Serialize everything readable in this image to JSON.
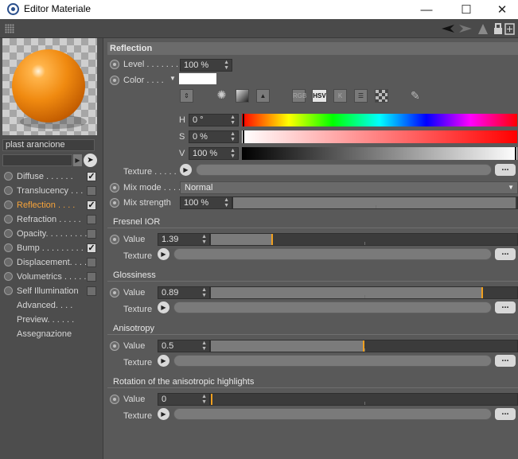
{
  "window": {
    "title": "Editor Materiale",
    "minimize": "—",
    "maximize": "☐",
    "close": "✕"
  },
  "material": {
    "name": "plast arancione"
  },
  "channels": [
    {
      "label": "Diffuse . . . . . .",
      "checked": true,
      "active": false
    },
    {
      "label": "Translucency . . .",
      "checked": false,
      "active": false
    },
    {
      "label": "Reflection . . . .",
      "checked": true,
      "active": true
    },
    {
      "label": "Refraction . . . . .",
      "checked": false,
      "active": false
    },
    {
      "label": "Opacity. . . . . . . . .",
      "checked": false,
      "active": false
    },
    {
      "label": "Bump . . . . . . . . .",
      "checked": true,
      "active": false
    },
    {
      "label": "Displacement. . . .",
      "checked": false,
      "active": false
    },
    {
      "label": "Volumetrics . . . . .",
      "checked": false,
      "active": false
    },
    {
      "label": "Self Illumination",
      "checked": false,
      "active": false
    }
  ],
  "extra_items": [
    "Advanced. . . .",
    "Preview. . . . . .",
    "Assegnazione"
  ],
  "check_mark": "✓",
  "reflection": {
    "title": "Reflection",
    "level_label": "Level . . . . . . .",
    "level_value": "100 %",
    "color_label": "Color . . . .",
    "color_swatch": "#ffffff",
    "icons": [
      "picker-icon",
      "wheel-icon",
      "spectrum-icon",
      "image-icon"
    ],
    "mode_buttons": {
      "rgb": "RGB",
      "hsv": "HSV",
      "k": "K"
    },
    "h_label": "H",
    "h_value": "0 °",
    "s_label": "S",
    "s_value": "0 %",
    "v_label": "V",
    "v_value": "100 %",
    "texture_label": "Texture . . . . .",
    "mixmode_label": "Mix mode . . . .",
    "mixmode_value": "Normal",
    "mixstrength_label": "Mix strength",
    "mixstrength_value": "100 %",
    "mixstrength_level": 1.0
  },
  "fresnel": {
    "title": "Fresnel IOR",
    "value_label": "Value",
    "value": "1.39",
    "level": 0.2,
    "texture_label": "Texture"
  },
  "glossiness": {
    "title": "Glossiness",
    "value_label": "Value",
    "value": "0.89",
    "level": 0.89,
    "texture_label": "Texture"
  },
  "anisotropy": {
    "title": "Anisotropy",
    "value_label": "Value",
    "value": "0.5",
    "level": 0.5,
    "texture_label": "Texture"
  },
  "rotation": {
    "title": "Rotation of the anisotropic highlights",
    "value_label": "Value",
    "value": "0",
    "level": 0.0,
    "texture_label": "Texture"
  },
  "browse": "...",
  "play": "▶",
  "spin": "▲▼"
}
